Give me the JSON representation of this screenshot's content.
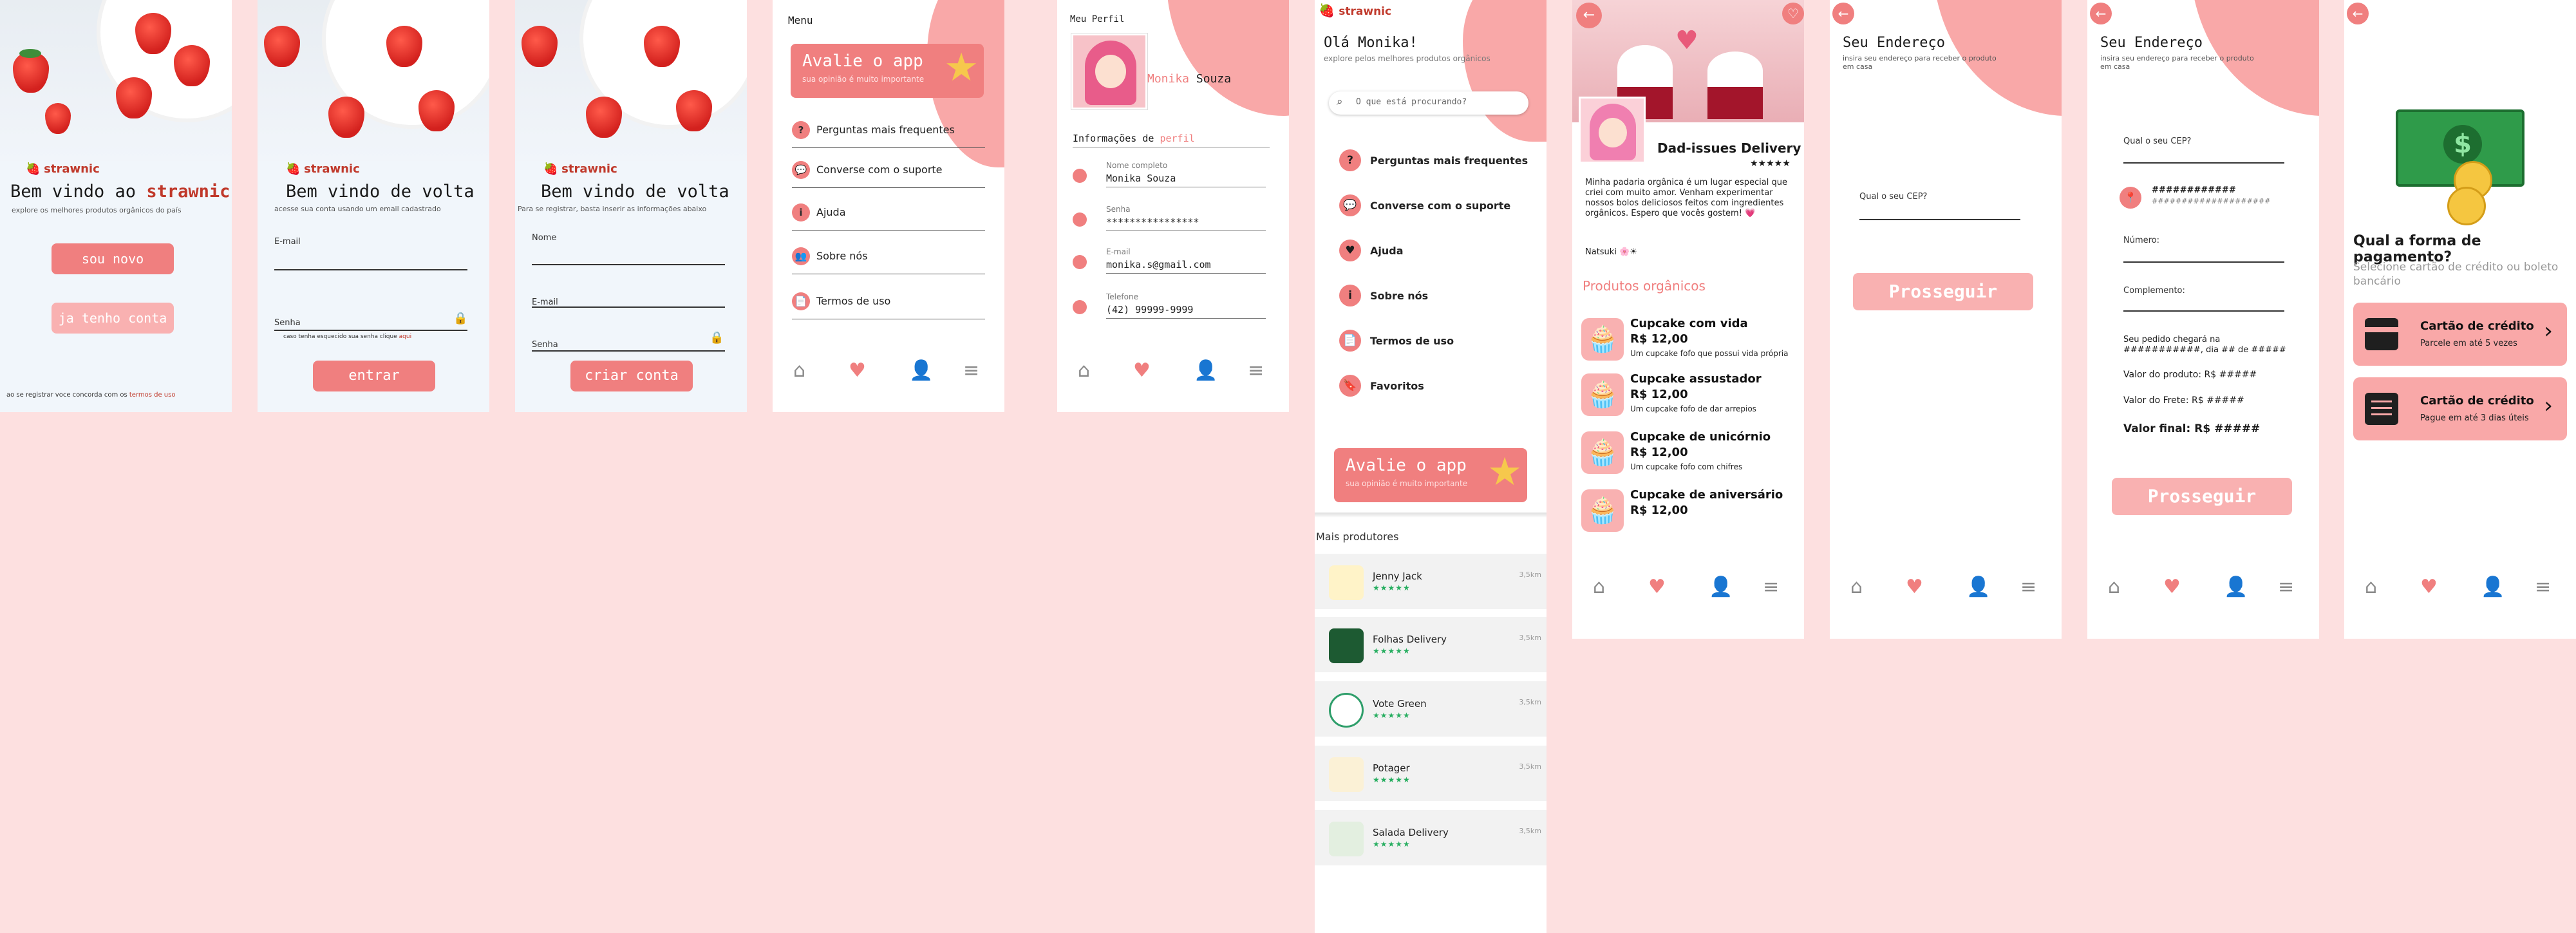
{
  "brand": "strawnic",
  "welcome": {
    "title_prefix": "Bem vindo ao",
    "title_brand": "strawnic",
    "subtitle": "explore os melhores produtos orgânicos do país",
    "btn_new": "sou novo",
    "btn_have": "ja tenho conta",
    "terms_prefix": "ao se registrar voce concorda com os",
    "terms_link": "termos de uso"
  },
  "login": {
    "title": "Bem vindo de volta",
    "subtitle": "acesse sua conta usando um email cadastrado",
    "email_label": "E-mail",
    "password_label": "Senha",
    "forgot_prefix": "caso tenha esquecido sua senha clique",
    "forgot_link": "aqui",
    "btn": "entrar"
  },
  "register": {
    "title": "Bem vindo de volta",
    "subtitle": "Para se registrar, basta inserir as informações abaixo",
    "name_label": "Nome",
    "email_label": "E-mail",
    "password_label": "Senha",
    "btn": "criar conta"
  },
  "menu": {
    "title": "Menu",
    "rate_title": "Avalie o app",
    "rate_sub": "sua opinião é muito importante",
    "items": [
      "Perguntas mais frequentes",
      "Converse com o suporte",
      "Ajuda",
      "Sobre nós",
      "Termos de uso"
    ]
  },
  "profile": {
    "title": "Meu Perfil",
    "first_name": "Monika",
    "last_name": "Souza",
    "section_prefix": "Informações de",
    "section_link": "perfil",
    "fields": [
      {
        "label": "Nome completo",
        "value": "Monika Souza"
      },
      {
        "label": "Senha",
        "value": "****************"
      },
      {
        "label": "E-mail",
        "value": "monika.s@gmail.com"
      },
      {
        "label": "Telefone",
        "value": "(42) 99999-9999"
      }
    ]
  },
  "home": {
    "greeting": "Olá Monika!",
    "subtitle": "explore pelos melhores produtos orgânicos",
    "search_placeholder": "O que está procurando?",
    "items": [
      "Perguntas mais frequentes",
      "Converse com o suporte",
      "Ajuda",
      "Sobre nós",
      "Termos de uso",
      "Favoritos"
    ],
    "rate_title": "Avalie o app",
    "rate_sub": "sua opinião é muito importante",
    "more_title": "Mais produtores",
    "stores": [
      {
        "name": "Jenny Jack",
        "rating": "★★★★★",
        "dist": "3,5km"
      },
      {
        "name": "Folhas Delivery",
        "rating": "★★★★★",
        "dist": "3,5km"
      },
      {
        "name": "Vote Green",
        "rating": "★★★★★",
        "dist": "3,5km"
      },
      {
        "name": "Potager",
        "rating": "★★★★★",
        "dist": "3,5km"
      },
      {
        "name": "Salada Delivery",
        "rating": "★★★★★",
        "dist": "3,5km"
      }
    ]
  },
  "store": {
    "name": "Dad-issues Delivery",
    "rating": "★★★★★",
    "description": "Minha padaria orgânica é um lugar especial que criei com muito amor. Venham experimentar nossos bolos deliciosos feitos com ingredientes orgânicos. Espero que vocês gostem! 💗",
    "signature": "Natsuki 🌸☀",
    "section_title": "Produtos orgânicos",
    "products": [
      {
        "name": "Cupcake com vida",
        "price": "R$ 12,00",
        "desc": "Um cupcake fofo que possui vida própria"
      },
      {
        "name": "Cupcake assustador",
        "price": "R$ 12,00",
        "desc": "Um cupcake fofo de dar arrepios"
      },
      {
        "name": "Cupcake de unicórnio",
        "price": "R$ 12,00",
        "desc": "Um cupcake fofo com chifres"
      },
      {
        "name": "Cupcake  de aniversário",
        "price": "R$ 12,00",
        "desc": ""
      }
    ]
  },
  "address1": {
    "title": "Seu Endereço",
    "subtitle": "insira seu endereço para receber o produto em casa",
    "cep_label": "Qual o seu CEP?",
    "btn": "Prosseguir"
  },
  "address2": {
    "title": "Seu Endereço",
    "subtitle": "insira seu endereço para receber o produto em casa",
    "cep_label": "Qual o seu CEP?",
    "street": "############",
    "street_sub": "####################",
    "number_label": "Número:",
    "complement_label": "Complemento:",
    "delivery_text": "Seu pedido chegará na ###########, dia ## de #####",
    "product_value": "Valor do produto: R$ #####",
    "shipping_value": "Valor do Frete: R$ #####",
    "final_value": "Valor final: R$ #####",
    "btn": "Prosseguir"
  },
  "payment": {
    "title": "Qual a forma de pagamento?",
    "subtitle": "Selecione cartão de crédito ou boleto bancário",
    "options": [
      {
        "title": "Cartão de crédito",
        "sub": "Parcele em até 5 vezes"
      },
      {
        "title": "Cartão de crédito",
        "sub": "Pague em até 3 dias úteis"
      }
    ]
  },
  "colors": {
    "accent": "#f07f7f",
    "pale": "#f9b1b1",
    "brand": "#c0392b",
    "background": "#fde0e0"
  }
}
